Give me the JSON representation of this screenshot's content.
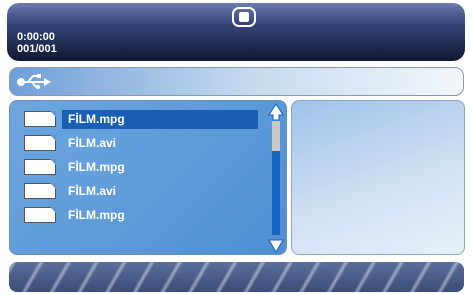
{
  "header": {
    "time": "0:00:00",
    "track_count": "001/001"
  },
  "path_bar": {
    "icon": "usb-icon"
  },
  "file_list": {
    "items": [
      {
        "name": "FİLM.mpg",
        "selected": true
      },
      {
        "name": "FİLM.avi",
        "selected": false
      },
      {
        "name": "FİLM.mpg",
        "selected": false
      },
      {
        "name": "FİLM.avi",
        "selected": false
      },
      {
        "name": "FİLM.mpg",
        "selected": false
      }
    ]
  },
  "colors": {
    "selection": "#1a5fb4",
    "panel": "#5b95d4",
    "header": "#1b2547"
  }
}
